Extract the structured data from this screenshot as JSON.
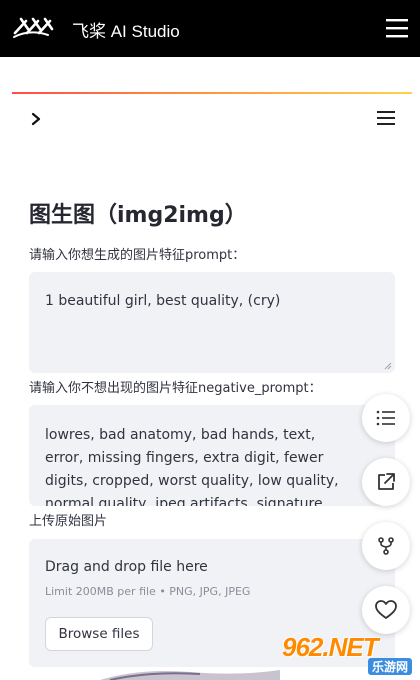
{
  "header": {
    "brand_text": "飞桨 AI Studio",
    "logo_icon": "paddle-logo-icon",
    "menu_icon": "hamburger-menu-icon"
  },
  "toolbar": {
    "expand_icon": "chevron-right-icon",
    "menu_icon": "hamburger-menu-icon"
  },
  "page": {
    "title": "图生图（img2img）"
  },
  "prompt": {
    "label": "请输入你想生成的图片特征prompt：",
    "value": "1 beautiful girl, best quality, (cry)"
  },
  "negative_prompt": {
    "label": "请输入你不想出现的图片特征negative_prompt：",
    "value": "lowres, bad anatomy, bad hands, text, error, missing fingers, extra digit, fewer digits, cropped, worst quality, low quality, normal quality, jpeg artifacts, signature, watermark,"
  },
  "upload": {
    "label": "上传原始图片",
    "drag_text": "Drag and drop file here",
    "limit_text": "Limit 200MB per file • PNG, JPG, JPEG",
    "browse_label": "Browse files"
  },
  "floating_actions": [
    {
      "icon": "list-icon"
    },
    {
      "icon": "external-link-icon"
    },
    {
      "icon": "fork-icon"
    },
    {
      "icon": "heart-icon"
    }
  ],
  "watermark": {
    "main": "962.NET",
    "sub": "乐游网"
  },
  "colors": {
    "topbar": "#000000",
    "accent_start": "#ff4b4b",
    "accent_end": "#ffd24d",
    "field_bg": "#f0f2f6"
  }
}
